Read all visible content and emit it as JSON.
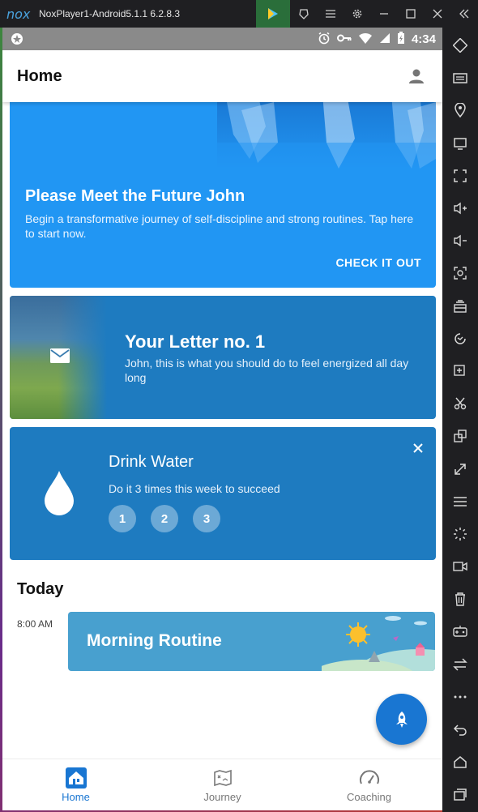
{
  "emulator": {
    "logo": "nox",
    "title": "NoxPlayer1-Android5.1.1 6.2.8.3",
    "titlebar_icons": [
      "play-store-icon",
      "pin-icon",
      "menu-icon",
      "settings-icon",
      "minimize-icon",
      "maximize-icon",
      "close-icon",
      "collapse-icon"
    ],
    "sidebar_icons": [
      "keyboard-mapping-icon",
      "virtual-keyboard-icon",
      "location-icon",
      "screen-icon",
      "fullscreen-icon",
      "volume-up-icon",
      "volume-down-icon",
      "screenshot-icon",
      "toolbox-icon",
      "rotate-icon",
      "apk-install-icon",
      "scissors-icon",
      "multi-instance-icon",
      "resize-icon",
      "menu-lines-icon",
      "loading-icon",
      "video-record-icon",
      "trash-icon",
      "gamepad-icon",
      "sync-icon",
      "more-icon",
      "back-icon",
      "home-icon",
      "recents-icon"
    ]
  },
  "statusbar": {
    "time": "4:34",
    "icons": [
      "alarm-icon",
      "key-icon",
      "wifi-icon",
      "signal-icon",
      "battery-icon"
    ]
  },
  "appbar": {
    "title": "Home"
  },
  "hero_card": {
    "title": "Please Meet the Future John",
    "description": "Begin a transformative journey of self-discipline and strong routines. Tap here to start now.",
    "cta": "CHECK IT OUT"
  },
  "letter_card": {
    "title": "Your Letter no. 1",
    "description": "John, this is what you should do to feel energized all day long"
  },
  "water_card": {
    "title": "Drink Water",
    "description": "Do it 3 times this week to succeed",
    "steps": [
      "1",
      "2",
      "3"
    ]
  },
  "today": {
    "title": "Today",
    "time": "8:00 AM",
    "routine_title": "Morning Routine"
  },
  "bottom_nav": {
    "items": [
      {
        "label": "Home",
        "active": true
      },
      {
        "label": "Journey",
        "active": false
      },
      {
        "label": "Coaching",
        "active": false
      }
    ]
  },
  "colors": {
    "accent": "#1976d2",
    "hero_blue": "#2196f3",
    "card_blue": "#1e7bc0",
    "routine_blue": "#48a0cf"
  }
}
